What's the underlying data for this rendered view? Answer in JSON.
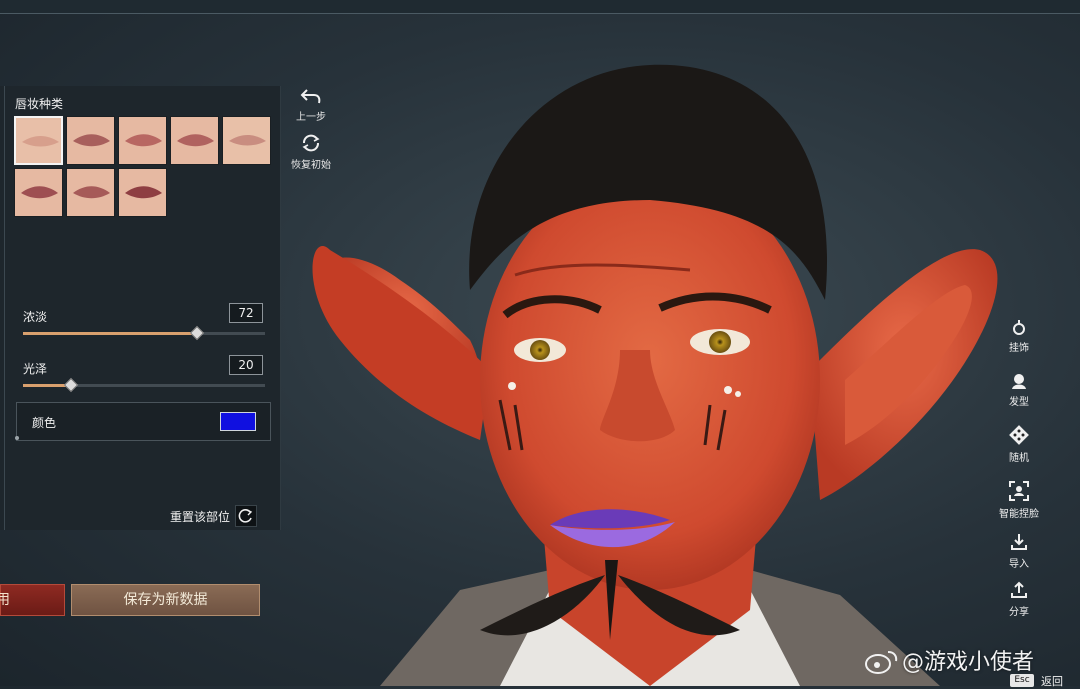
{
  "panel": {
    "section_title": "唇妆种类",
    "swatch_count": 8,
    "selected_swatch": 0,
    "sliders": [
      {
        "label": "浓淡",
        "value": "72",
        "fraction": 0.72
      },
      {
        "label": "光泽",
        "value": "20",
        "fraction": 0.2
      }
    ],
    "color": {
      "label": "颜色",
      "value": "#1010e0"
    },
    "reset_part_label": "重置该部位"
  },
  "tools": {
    "undo_label": "上一步",
    "restore_label": "恢复初始"
  },
  "bottom": {
    "apply_label": "用",
    "save_new_label": "保存为新数据"
  },
  "right_menu": [
    {
      "label": "挂饰",
      "icon": "pendant-icon"
    },
    {
      "label": "发型",
      "icon": "hairstyle-icon"
    },
    {
      "label": "随机",
      "icon": "random-dice-icon"
    },
    {
      "label": "智能捏脸",
      "icon": "smart-face-icon"
    },
    {
      "label": "导入",
      "icon": "import-icon"
    },
    {
      "label": "分享",
      "icon": "share-icon"
    }
  ],
  "esc": {
    "key": "Esc",
    "label": "返回"
  },
  "watermark": "@游戏小使者",
  "colors": {
    "lip_color": "#1010e0",
    "slider_fill": "#d9a06e",
    "apply_button": "#7a211b",
    "save_button": "#7d5f4b"
  }
}
